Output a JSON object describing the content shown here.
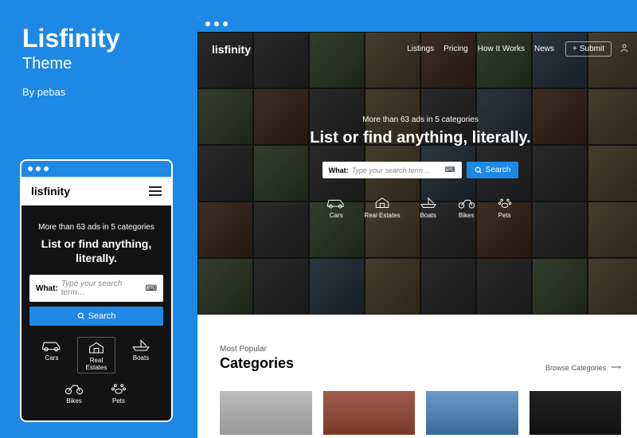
{
  "product": {
    "title": "Lisfinity",
    "subtitle": "Theme",
    "author": "By pebas"
  },
  "logo": "lisfinity",
  "hero": {
    "tagline": "More than 63 ads in 5 categories",
    "headline_desktop": "List or find anything, literally.",
    "headline_mobile": "List or find anything, literally."
  },
  "search": {
    "what_label": "What:",
    "placeholder": "Type your search term…",
    "button": "Search"
  },
  "categories": [
    {
      "key": "cars",
      "label": "Cars"
    },
    {
      "key": "real-estates",
      "label": "Real Estates"
    },
    {
      "key": "boats",
      "label": "Boats"
    },
    {
      "key": "bikes",
      "label": "Bikes"
    },
    {
      "key": "pets",
      "label": "Pets"
    }
  ],
  "nav": {
    "listings": "Listings",
    "pricing": "Pricing",
    "how": "How It Works",
    "news": "News",
    "submit": "Submit"
  },
  "lower_section": {
    "label": "Most Popular",
    "title": "Categories",
    "browse": "Browse Categories"
  }
}
